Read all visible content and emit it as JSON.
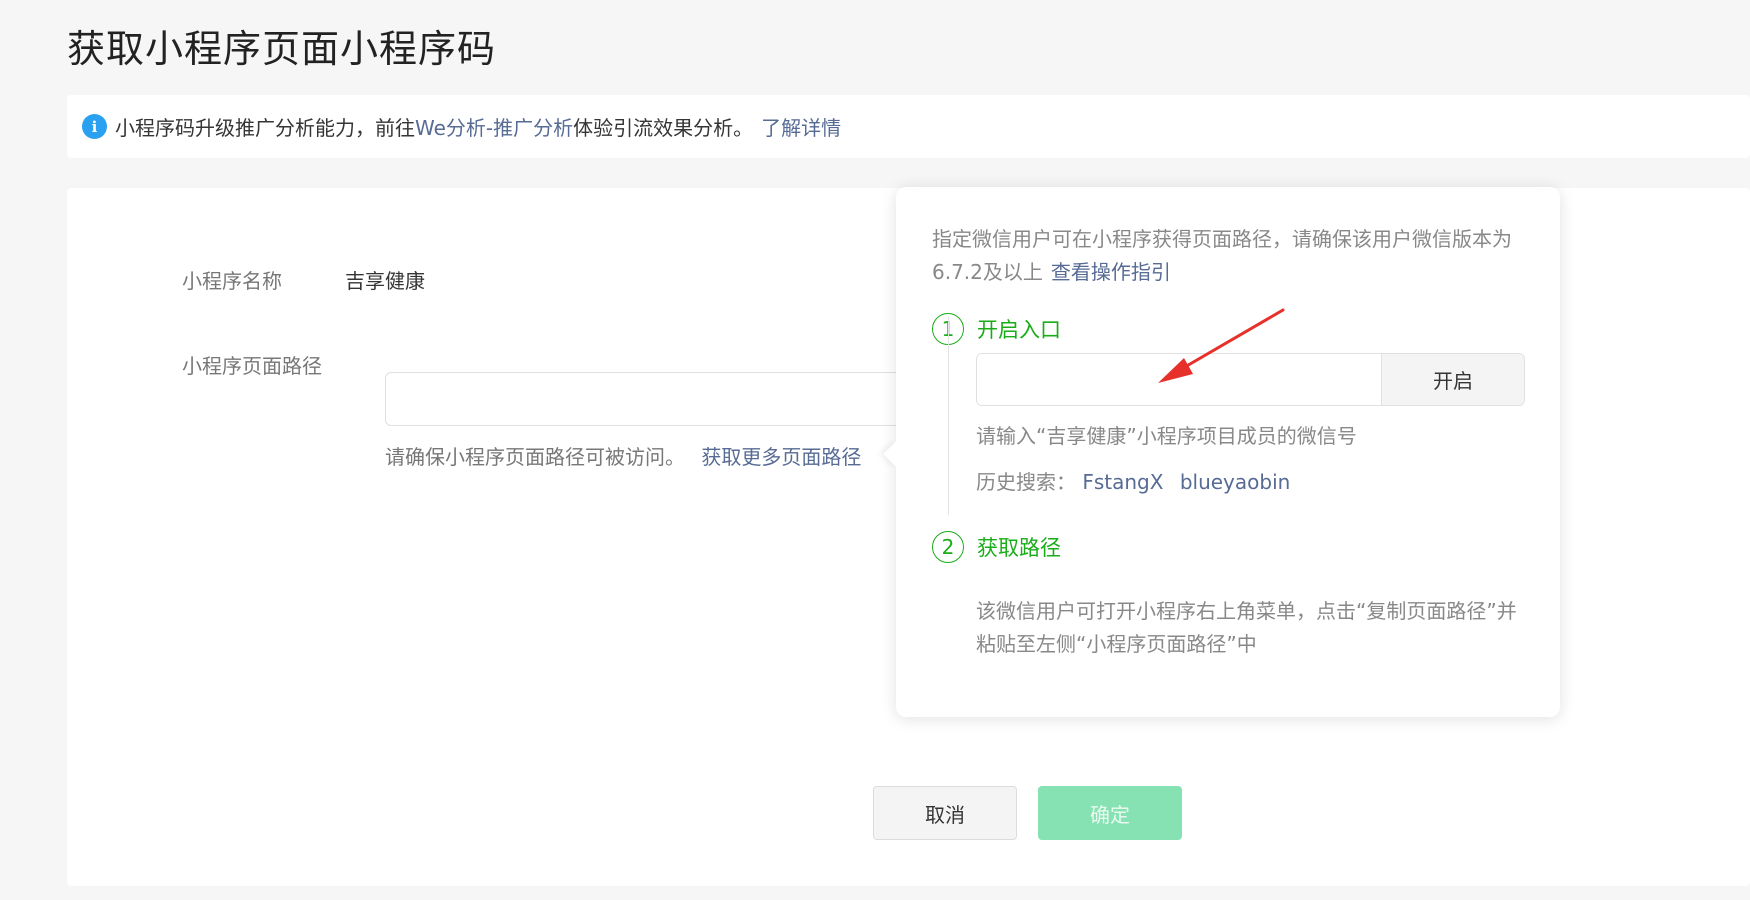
{
  "page": {
    "title": "获取小程序页面小程序码"
  },
  "notice": {
    "icon": "info-icon",
    "text_before": "小程序码升级推广分析能力，前往",
    "link_text": "We分析-推广分析",
    "text_after": "体验引流效果分析。",
    "detail_link": "了解详情"
  },
  "form": {
    "name_label": "小程序名称",
    "name_value": "吉享健康",
    "path_label": "小程序页面路径",
    "path_value": "",
    "path_placeholder": "",
    "path_hint": "请确保小程序页面路径可被访问。",
    "path_hint_link": "获取更多页面路径"
  },
  "popover": {
    "desc": "指定微信用户可在小程序获得页面路径，请确保该用户微信版本为6.7.2及以上",
    "guide_link": "查看操作指引",
    "step1": {
      "number": "1",
      "title": "开启入口",
      "input_value": "",
      "button_label": "开启",
      "hint": "请输入“吉享健康”小程序项目成员的微信号",
      "history_label": "历史搜索：",
      "history_items": [
        "FstangX",
        "blueyaobin"
      ]
    },
    "step2": {
      "number": "2",
      "title": "获取路径",
      "desc": "该微信用户可打开小程序右上角菜单，点击“复制页面路径”并粘贴至左侧“小程序页面路径”中"
    }
  },
  "actions": {
    "cancel_label": "取消",
    "confirm_label": "确定"
  },
  "colors": {
    "link": "#576b95",
    "green": "#1aad19",
    "confirm_disabled": "#86e2b3",
    "annotation_arrow": "#e8302a"
  }
}
